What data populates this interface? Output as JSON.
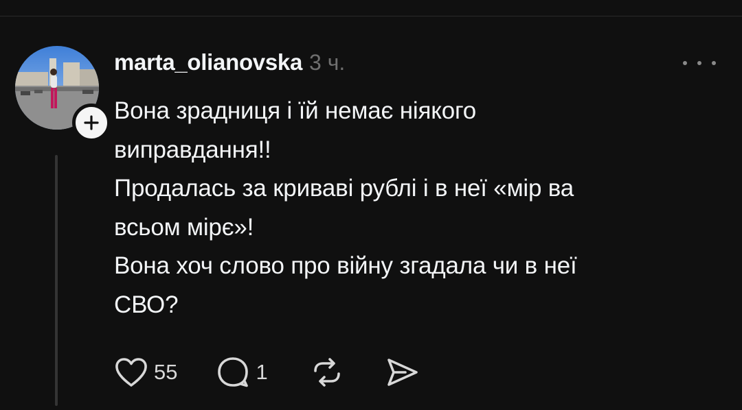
{
  "post": {
    "username": "marta_olianovska",
    "timestamp": "3 ч.",
    "body_lines": [
      "Вона зрадниця і їй немає ніякого",
      "виправдання!!",
      "Продалась за криваві рублі і в неї «мір ва",
      "всьом мірє»!",
      "Вона хоч слово про війну згадала чи в неї",
      "СВО?"
    ]
  },
  "actions": {
    "like_count": "55",
    "reply_count": "1"
  },
  "icons": {
    "more": "more-horizontal-icon",
    "follow": "plus-icon",
    "like": "heart-icon",
    "reply": "comment-icon",
    "repost": "repost-icon",
    "share": "send-icon"
  },
  "colors": {
    "background": "#101010",
    "text": "#f3f5f7",
    "muted": "#6f6f6f",
    "thread_line": "#343434"
  }
}
